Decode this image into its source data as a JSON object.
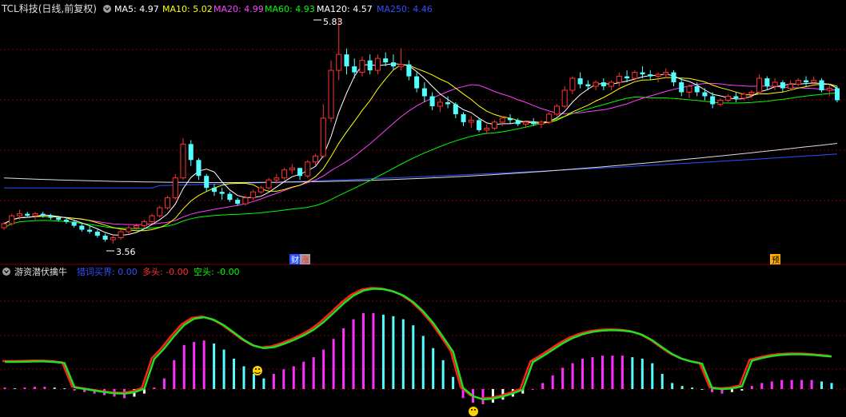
{
  "top_header": {
    "title": "TCL科技(日线,前复权)",
    "ma": [
      {
        "label": "MA5: 4.97",
        "color": "#ffffff"
      },
      {
        "label": "MA10: 5.02",
        "color": "#ffff00"
      },
      {
        "label": "MA20: 4.99",
        "color": "#ff40ff"
      },
      {
        "label": "MA60: 4.93",
        "color": "#00ff00"
      },
      {
        "label": "MA120: 4.57",
        "color": "#ffffff"
      },
      {
        "label": "MA250: 4.46",
        "color": "#3050ff"
      }
    ]
  },
  "markers": {
    "high": "5.83",
    "low": "3.56",
    "badge1": "财",
    "badge2": "涨",
    "badge3": "预"
  },
  "bottom_header": {
    "title": "游资潜伏擒牛",
    "items": [
      {
        "label": "猎词买界: 0.00",
        "color": "#3050ff"
      },
      {
        "label": "多头: -0.00",
        "color": "#ff3030"
      },
      {
        "label": "空头: -0.00",
        "color": "#00ff00"
      }
    ]
  },
  "chart_data": [
    {
      "type": "candlestick",
      "title": "TCL科技(日线,前复权)",
      "annotated_high": 5.83,
      "annotated_low": 3.56,
      "ma_values": {
        "MA5": 4.97,
        "MA10": 5.02,
        "MA20": 4.99,
        "MA60": 4.93,
        "MA120": 4.57,
        "MA250": 4.46
      },
      "candles": [
        [
          3.72,
          3.78,
          3.7,
          3.76
        ],
        [
          3.76,
          3.86,
          3.74,
          3.84
        ],
        [
          3.84,
          3.9,
          3.8,
          3.86
        ],
        [
          3.86,
          3.88,
          3.82,
          3.84
        ],
        [
          3.84,
          3.88,
          3.8,
          3.86
        ],
        [
          3.86,
          3.88,
          3.82,
          3.84
        ],
        [
          3.84,
          3.86,
          3.8,
          3.82
        ],
        [
          3.82,
          3.84,
          3.78,
          3.8
        ],
        [
          3.8,
          3.82,
          3.76,
          3.78
        ],
        [
          3.78,
          3.8,
          3.72,
          3.74
        ],
        [
          3.74,
          3.76,
          3.68,
          3.7
        ],
        [
          3.7,
          3.74,
          3.66,
          3.68
        ],
        [
          3.68,
          3.7,
          3.62,
          3.64
        ],
        [
          3.64,
          3.66,
          3.58,
          3.6
        ],
        [
          3.6,
          3.64,
          3.56,
          3.62
        ],
        [
          3.62,
          3.7,
          3.6,
          3.68
        ],
        [
          3.68,
          3.74,
          3.66,
          3.72
        ],
        [
          3.72,
          3.76,
          3.7,
          3.74
        ],
        [
          3.74,
          3.8,
          3.72,
          3.78
        ],
        [
          3.78,
          3.86,
          3.76,
          3.84
        ],
        [
          3.84,
          3.94,
          3.82,
          3.92
        ],
        [
          3.92,
          4.04,
          3.9,
          4.02
        ],
        [
          4.02,
          4.26,
          4.0,
          4.22
        ],
        [
          4.22,
          4.62,
          4.2,
          4.56
        ],
        [
          4.56,
          4.6,
          4.34,
          4.4
        ],
        [
          4.4,
          4.42,
          4.2,
          4.24
        ],
        [
          4.24,
          4.26,
          4.08,
          4.12
        ],
        [
          4.12,
          4.16,
          4.04,
          4.08
        ],
        [
          4.08,
          4.12,
          4.0,
          4.06
        ],
        [
          4.06,
          4.08,
          3.98,
          4.0
        ],
        [
          4.0,
          4.02,
          3.94,
          3.96
        ],
        [
          3.96,
          4.04,
          3.94,
          4.02
        ],
        [
          4.02,
          4.1,
          4.0,
          4.08
        ],
        [
          4.08,
          4.14,
          4.06,
          4.12
        ],
        [
          4.12,
          4.22,
          4.1,
          4.2
        ],
        [
          4.2,
          4.26,
          4.16,
          4.22
        ],
        [
          4.22,
          4.32,
          4.2,
          4.3
        ],
        [
          4.3,
          4.36,
          4.26,
          4.32
        ],
        [
          4.32,
          4.3,
          4.2,
          4.24
        ],
        [
          4.24,
          4.4,
          4.22,
          4.38
        ],
        [
          4.38,
          4.46,
          4.34,
          4.44
        ],
        [
          4.44,
          4.96,
          4.42,
          4.82
        ],
        [
          4.82,
          5.4,
          4.78,
          5.3
        ],
        [
          5.3,
          5.83,
          5.2,
          5.46
        ],
        [
          5.46,
          5.52,
          5.26,
          5.34
        ],
        [
          5.34,
          5.42,
          5.22,
          5.28
        ],
        [
          5.28,
          5.44,
          5.24,
          5.4
        ],
        [
          5.4,
          5.46,
          5.26,
          5.3
        ],
        [
          5.3,
          5.46,
          5.26,
          5.42
        ],
        [
          5.42,
          5.48,
          5.34,
          5.38
        ],
        [
          5.38,
          5.46,
          5.3,
          5.34
        ],
        [
          5.34,
          5.52,
          5.3,
          5.36
        ],
        [
          5.36,
          5.4,
          5.2,
          5.24
        ],
        [
          5.24,
          5.28,
          5.08,
          5.12
        ],
        [
          5.12,
          5.18,
          4.98,
          5.04
        ],
        [
          5.04,
          5.08,
          4.9,
          4.94
        ],
        [
          4.94,
          5.02,
          4.88,
          4.98
        ],
        [
          4.98,
          5.04,
          4.92,
          4.96
        ],
        [
          4.96,
          4.98,
          4.82,
          4.86
        ],
        [
          4.86,
          4.88,
          4.74,
          4.78
        ],
        [
          4.78,
          4.84,
          4.72,
          4.8
        ],
        [
          4.8,
          4.82,
          4.68,
          4.7
        ],
        [
          4.7,
          4.76,
          4.66,
          4.72
        ],
        [
          4.72,
          4.8,
          4.7,
          4.78
        ],
        [
          4.78,
          4.84,
          4.74,
          4.82
        ],
        [
          4.82,
          4.86,
          4.76,
          4.8
        ],
        [
          4.8,
          4.82,
          4.74,
          4.76
        ],
        [
          4.76,
          4.8,
          4.72,
          4.78
        ],
        [
          4.78,
          4.82,
          4.74,
          4.76
        ],
        [
          4.76,
          4.8,
          4.72,
          4.78
        ],
        [
          4.78,
          4.88,
          4.76,
          4.86
        ],
        [
          4.86,
          4.96,
          4.84,
          4.94
        ],
        [
          4.94,
          5.14,
          4.92,
          5.1
        ],
        [
          5.1,
          5.24,
          5.06,
          5.22
        ],
        [
          5.22,
          5.28,
          5.12,
          5.16
        ],
        [
          5.16,
          5.2,
          5.1,
          5.14
        ],
        [
          5.14,
          5.2,
          5.1,
          5.18
        ],
        [
          5.18,
          5.22,
          5.1,
          5.14
        ],
        [
          5.14,
          5.2,
          5.1,
          5.18
        ],
        [
          5.18,
          5.28,
          5.14,
          5.24
        ],
        [
          5.24,
          5.3,
          5.18,
          5.22
        ],
        [
          5.22,
          5.3,
          5.2,
          5.28
        ],
        [
          5.28,
          5.34,
          5.22,
          5.26
        ],
        [
          5.26,
          5.3,
          5.2,
          5.24
        ],
        [
          5.24,
          5.28,
          5.18,
          5.26
        ],
        [
          5.26,
          5.32,
          5.22,
          5.28
        ],
        [
          5.28,
          5.3,
          5.14,
          5.18
        ],
        [
          5.18,
          5.22,
          5.04,
          5.08
        ],
        [
          5.08,
          5.16,
          5.02,
          5.14
        ],
        [
          5.14,
          5.18,
          5.04,
          5.08
        ],
        [
          5.08,
          5.12,
          5.0,
          5.04
        ],
        [
          5.04,
          5.08,
          4.92,
          4.96
        ],
        [
          4.96,
          5.02,
          4.94,
          5.0
        ],
        [
          5.0,
          5.06,
          4.98,
          5.04
        ],
        [
          5.04,
          5.08,
          4.98,
          5.02
        ],
        [
          5.02,
          5.08,
          5.0,
          5.06
        ],
        [
          5.06,
          5.1,
          5.02,
          5.08
        ],
        [
          5.08,
          5.26,
          5.06,
          5.22
        ],
        [
          5.22,
          5.24,
          5.1,
          5.14
        ],
        [
          5.14,
          5.22,
          5.1,
          5.18
        ],
        [
          5.18,
          5.2,
          5.08,
          5.12
        ],
        [
          5.12,
          5.2,
          5.1,
          5.16
        ],
        [
          5.16,
          5.22,
          5.14,
          5.2
        ],
        [
          5.2,
          5.24,
          5.14,
          5.18
        ],
        [
          5.18,
          5.24,
          5.14,
          5.2
        ],
        [
          5.2,
          5.22,
          5.08,
          5.1
        ],
        [
          5.1,
          5.16,
          5.04,
          5.12
        ],
        [
          5.12,
          5.14,
          4.98,
          5.0
        ]
      ]
    },
    {
      "type": "bar",
      "title": "游资潜伏擒牛",
      "series_histogram": [
        2,
        1,
        2,
        3,
        3,
        2,
        1,
        -2,
        -4,
        -6,
        -8,
        -10,
        -12,
        -10,
        -6,
        2,
        14,
        38,
        58,
        62,
        64,
        60,
        52,
        40,
        30,
        20,
        14,
        20,
        26,
        30,
        36,
        42,
        52,
        66,
        80,
        92,
        100,
        100,
        98,
        96,
        92,
        84,
        70,
        54,
        38,
        16,
        -12,
        -18,
        -20,
        -18,
        -14,
        -10,
        -6,
        0,
        8,
        18,
        28,
        34,
        40,
        42,
        44,
        44,
        44,
        42,
        40,
        34,
        20,
        8,
        4,
        2,
        0,
        -4,
        -6,
        -4,
        -2,
        4,
        8,
        10,
        12,
        12,
        12,
        12,
        10,
        8
      ],
      "header_values": {
        "猎词买界": 0.0,
        "多头": -0.0,
        "空头": -0.0
      }
    }
  ]
}
